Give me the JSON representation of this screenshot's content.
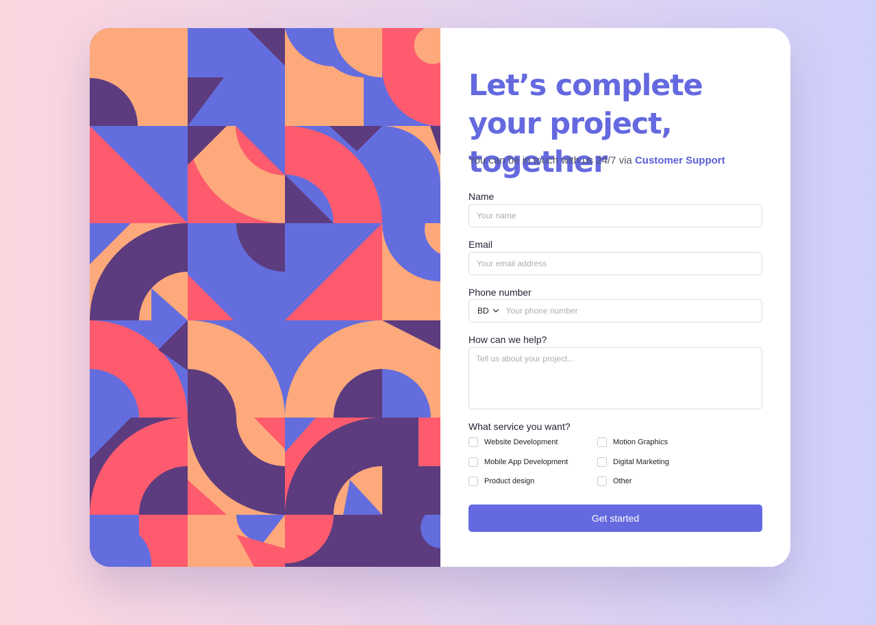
{
  "colors": {
    "accent": "#6469df",
    "palette": {
      "periwinkle": "#646dde",
      "purple": "#5c3c7e",
      "coral": "#fe5b6e",
      "peach": "#fea97b"
    }
  },
  "form": {
    "headline": "Let’s complete your project, together",
    "subtitle_text": "You can be in touch with us 24/7 via ",
    "subtitle_link": "Customer Support",
    "name": {
      "label": "Name",
      "placeholder": "Your name",
      "value": ""
    },
    "email": {
      "label": "Email",
      "placeholder": "Your email address",
      "value": ""
    },
    "phone": {
      "label": "Phone number",
      "country_code": "BD",
      "placeholder": "Your phone number",
      "value": ""
    },
    "message": {
      "label": "How can we help?",
      "placeholder": "Tell us about your project...",
      "value": ""
    },
    "services": {
      "label": "What service you want?",
      "options": [
        {
          "label": "Website Development",
          "checked": false
        },
        {
          "label": "Motion Graphics",
          "checked": false
        },
        {
          "label": "Mobile App Development",
          "checked": false
        },
        {
          "label": "Digital Marketing",
          "checked": false
        },
        {
          "label": "Product design",
          "checked": false
        },
        {
          "label": "Other",
          "checked": false
        }
      ]
    },
    "submit_label": "Get started"
  }
}
